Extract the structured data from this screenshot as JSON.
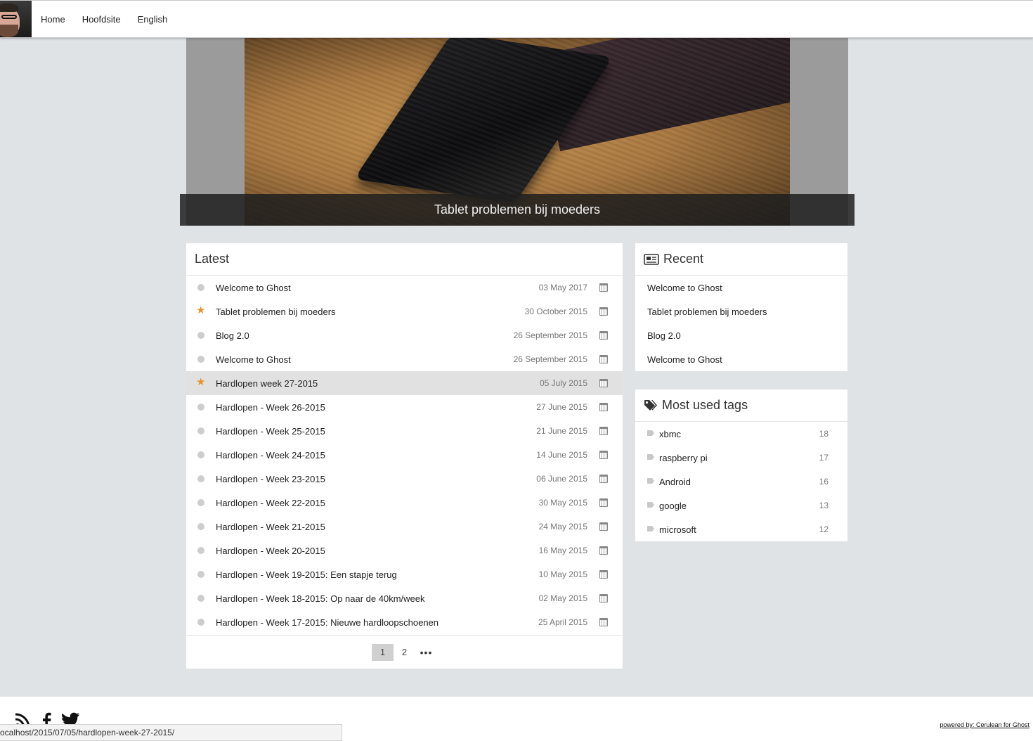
{
  "nav": {
    "items": [
      {
        "label": "Home"
      },
      {
        "label": "Hoofdsite"
      },
      {
        "label": "English"
      }
    ]
  },
  "hero": {
    "caption": "Tablet problemen bij moeders"
  },
  "latest": {
    "title": "Latest",
    "posts": [
      {
        "title": "Welcome to Ghost",
        "date": "03 May 2017",
        "featured": false
      },
      {
        "title": "Tablet problemen bij moeders",
        "date": "30 October 2015",
        "featured": true
      },
      {
        "title": "Blog 2.0",
        "date": "26 September 2015",
        "featured": false
      },
      {
        "title": "Welcome to Ghost",
        "date": "26 September 2015",
        "featured": false
      },
      {
        "title": "Hardlopen week 27-2015",
        "date": "05 July 2015",
        "featured": true
      },
      {
        "title": "Hardlopen - Week 26-2015",
        "date": "27 June 2015",
        "featured": false
      },
      {
        "title": "Hardlopen - Week 25-2015",
        "date": "21 June 2015",
        "featured": false
      },
      {
        "title": "Hardlopen - Week 24-2015",
        "date": "14 June 2015",
        "featured": false
      },
      {
        "title": "Hardlopen - Week 23-2015",
        "date": "06 June 2015",
        "featured": false
      },
      {
        "title": "Hardlopen - Week 22-2015",
        "date": "30 May 2015",
        "featured": false
      },
      {
        "title": "Hardlopen - Week 21-2015",
        "date": "24 May 2015",
        "featured": false
      },
      {
        "title": "Hardlopen - Week 20-2015",
        "date": "16 May 2015",
        "featured": false
      },
      {
        "title": "Hardlopen - Week 19-2015: Een stapje terug",
        "date": "10 May 2015",
        "featured": false
      },
      {
        "title": "Hardlopen - Week 18-2015: Op naar de 40km/week",
        "date": "02 May 2015",
        "featured": false
      },
      {
        "title": "Hardlopen - Week 17-2015: Nieuwe hardloopschoenen",
        "date": "25 April 2015",
        "featured": false
      }
    ],
    "pagination": {
      "pages": [
        "1",
        "2"
      ],
      "current": "1",
      "more": "•••"
    }
  },
  "recent": {
    "title": "Recent",
    "items": [
      "Welcome to Ghost",
      "Tablet problemen bij moeders",
      "Blog 2.0",
      "Welcome to Ghost"
    ]
  },
  "tags": {
    "title": "Most used tags",
    "items": [
      {
        "name": "xbmc",
        "count": "18"
      },
      {
        "name": "raspberry pi",
        "count": "17"
      },
      {
        "name": "Android",
        "count": "16"
      },
      {
        "name": "google",
        "count": "13"
      },
      {
        "name": "microsoft",
        "count": "12"
      }
    ]
  },
  "footer": {
    "powered_by": "powered by: Cerulean for Ghost"
  },
  "status_bar": {
    "url": "ocalhost/2015/07/05/hardlopen-week-27-2015/"
  },
  "colors": {
    "page_bg": "#e0e3e6",
    "featured_star": "#e8932a",
    "hover_row": "#e1e1e1"
  }
}
